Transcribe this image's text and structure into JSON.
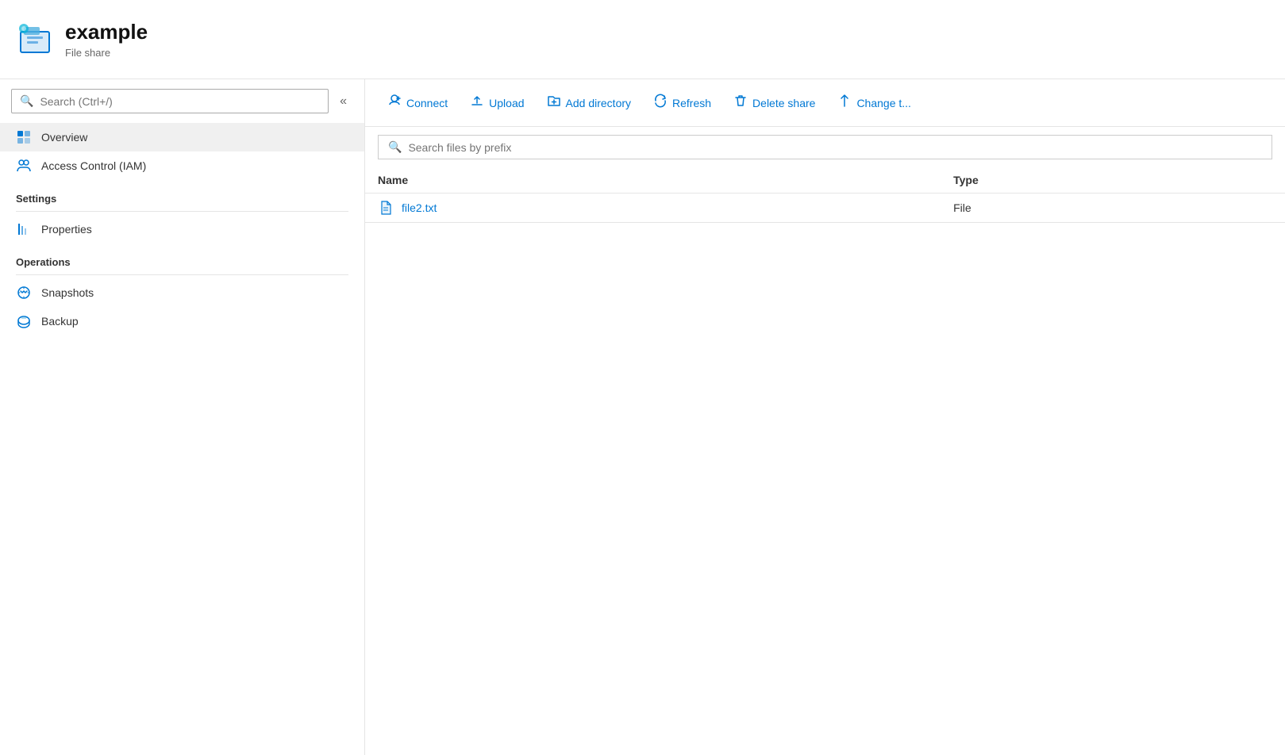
{
  "header": {
    "title": "example",
    "subtitle": "File share",
    "icon_label": "file-share-icon"
  },
  "sidebar": {
    "search_placeholder": "Search (Ctrl+/)",
    "nav_items": [
      {
        "id": "overview",
        "label": "Overview",
        "icon": "overview-icon",
        "active": true
      },
      {
        "id": "access-control",
        "label": "Access Control (IAM)",
        "icon": "iam-icon",
        "active": false
      }
    ],
    "sections": [
      {
        "label": "Settings",
        "items": [
          {
            "id": "properties",
            "label": "Properties",
            "icon": "properties-icon"
          }
        ]
      },
      {
        "label": "Operations",
        "items": [
          {
            "id": "snapshots",
            "label": "Snapshots",
            "icon": "snapshots-icon"
          },
          {
            "id": "backup",
            "label": "Backup",
            "icon": "backup-icon"
          }
        ]
      }
    ]
  },
  "toolbar": {
    "buttons": [
      {
        "id": "connect",
        "label": "Connect",
        "icon": "connect-icon"
      },
      {
        "id": "upload",
        "label": "Upload",
        "icon": "upload-icon"
      },
      {
        "id": "add-directory",
        "label": "Add directory",
        "icon": "add-directory-icon"
      },
      {
        "id": "refresh",
        "label": "Refresh",
        "icon": "refresh-icon"
      },
      {
        "id": "delete-share",
        "label": "Delete share",
        "icon": "delete-share-icon"
      },
      {
        "id": "change-tier",
        "label": "Change t...",
        "icon": "change-tier-icon"
      }
    ]
  },
  "file_area": {
    "search_placeholder": "Search files by prefix",
    "columns": [
      {
        "id": "name",
        "label": "Name"
      },
      {
        "id": "type",
        "label": "Type"
      }
    ],
    "files": [
      {
        "id": "file2",
        "name": "file2.txt",
        "type": "File"
      }
    ]
  }
}
